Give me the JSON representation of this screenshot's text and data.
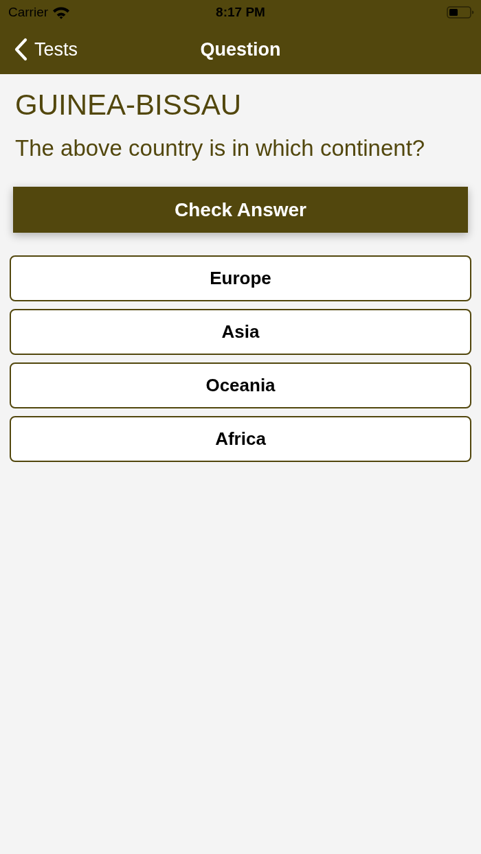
{
  "status_bar": {
    "carrier": "Carrier",
    "time": "8:17 PM"
  },
  "nav_bar": {
    "back_label": "Tests",
    "title": "Question"
  },
  "country": "GUINEA-BISSAU",
  "question": "The above country is in which continent?",
  "check_button": "Check Answer",
  "answers": [
    {
      "label": "Europe",
      "selected": false
    },
    {
      "label": "Asia",
      "selected": false
    },
    {
      "label": "Oceania",
      "selected": false
    },
    {
      "label": "Africa",
      "selected": false
    }
  ]
}
